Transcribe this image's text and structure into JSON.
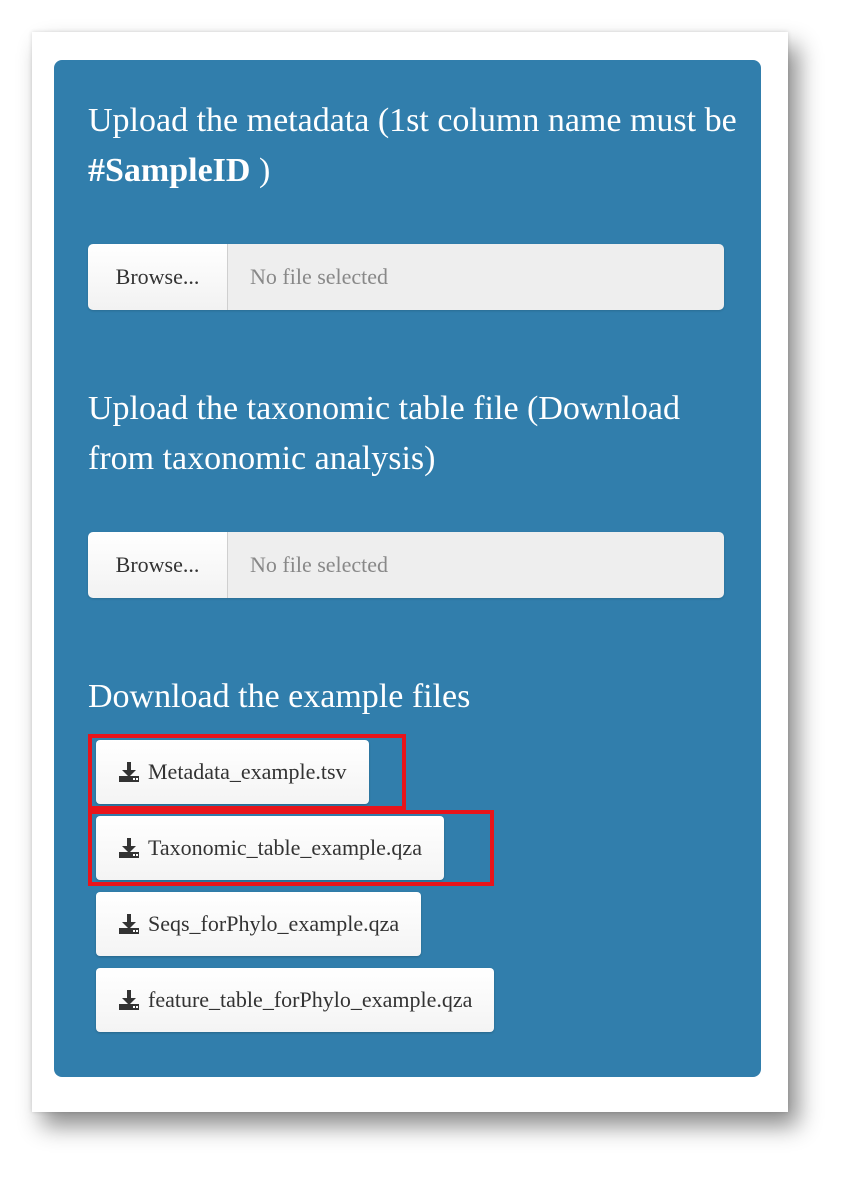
{
  "metadata_upload": {
    "label_part1": "Upload the metadata (1st column name must be ",
    "label_bold": "#SampleID",
    "label_part2": " )",
    "browse_label": "Browse...",
    "file_placeholder": "No file selected"
  },
  "taxonomic_upload": {
    "label": "Upload the taxonomic table file (Download from taxonomic analysis)",
    "browse_label": "Browse...",
    "file_placeholder": "No file selected"
  },
  "downloads": {
    "heading": "Download the example files",
    "items": [
      {
        "label": "Metadata_example.tsv",
        "icon": "download-icon"
      },
      {
        "label": "Taxonomic_table_example.qza",
        "icon": "download-icon"
      },
      {
        "label": "Seqs_forPhylo_example.qza",
        "icon": "download-icon"
      },
      {
        "label": "feature_table_forPhylo_example.qza",
        "icon": "download-icon"
      }
    ]
  },
  "colors": {
    "panel": "#317eac",
    "highlight": "#e8141b"
  }
}
